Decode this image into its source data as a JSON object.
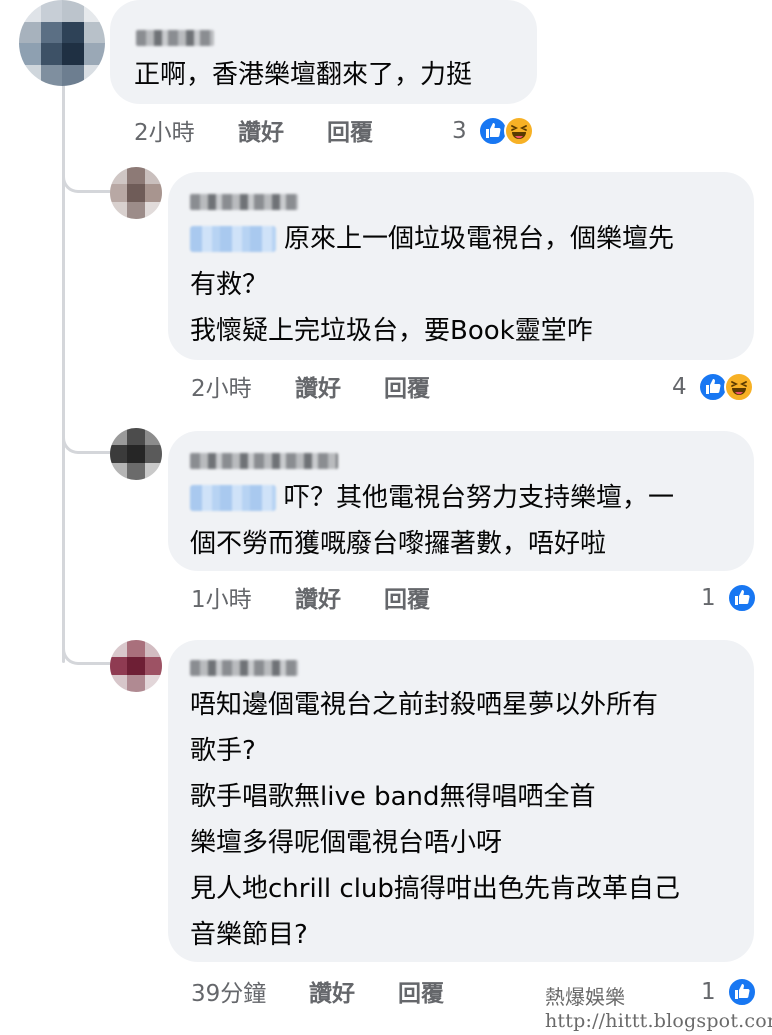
{
  "comments": [
    {
      "text_lines": [
        "正啊，香港樂壇翻來了，力挺"
      ],
      "time": "2小時",
      "like_label": "讚好",
      "reply_label": "回覆",
      "reaction_count": "3",
      "reactions": [
        "like-icon",
        "haha-icon"
      ]
    },
    {
      "text_lines": [
        "原來上一個垃圾電視台，個樂壇先",
        "有救？",
        "我懷疑上完垃圾台，要Book靈堂咋"
      ],
      "time": "2小時",
      "like_label": "讚好",
      "reply_label": "回覆",
      "reaction_count": "4",
      "reactions": [
        "like-icon",
        "haha-icon"
      ]
    },
    {
      "text_lines": [
        "吓？其他電視台努力支持樂壇，一",
        "個不勞而獲嘅廢台嚟攞著數，唔好啦"
      ],
      "time": "1小時",
      "like_label": "讚好",
      "reply_label": "回覆",
      "reaction_count": "1",
      "reactions": [
        "like-icon"
      ]
    },
    {
      "text_lines": [
        "唔知邊個電視台之前封殺哂星夢以外所有",
        "歌手?",
        "歌手唱歌無live band無得唱哂全首",
        "樂壇多得呢個電視台唔小呀",
        "見人地chrill club搞得咁出色先肯改革自己",
        "音樂節目?"
      ],
      "time": "39分鐘",
      "like_label": "讚好",
      "reply_label": "回覆",
      "reaction_count": "1",
      "reactions": [
        "like-icon"
      ]
    }
  ],
  "watermark": {
    "title": "熱爆娛樂",
    "url": "http://hittt.blogspot.com"
  },
  "colors": {
    "bubble": "#f0f2f5",
    "text": "#050505",
    "meta": "#65676b",
    "like_blue": "#1877f2",
    "haha_yellow": "#f7b125",
    "thread_line": "#d4d6da"
  }
}
